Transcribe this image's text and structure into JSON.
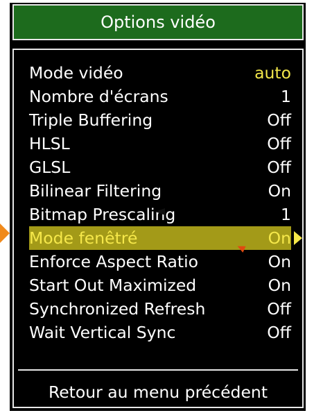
{
  "title": "Options vidéo",
  "items": [
    {
      "label": "Mode vidéo",
      "value": "auto"
    },
    {
      "label": "Nombre d'écrans",
      "value": "1"
    },
    {
      "label": "Triple Buffering",
      "value": "Off"
    },
    {
      "label": "HLSL",
      "value": "Off"
    },
    {
      "label": "GLSL",
      "value": "Off"
    },
    {
      "label": "Bilinear Filtering",
      "value": "On"
    },
    {
      "label": "Bitmap Prescaling",
      "value": "1"
    },
    {
      "label": "Mode fenêtré",
      "value": "On"
    },
    {
      "label": "Enforce Aspect Ratio",
      "value": "On"
    },
    {
      "label": "Start Out Maximized",
      "value": "On"
    },
    {
      "label": "Synchronized Refresh",
      "value": "Off"
    },
    {
      "label": "Wait Vertical Sync",
      "value": "Off"
    }
  ],
  "selected_item": "Mode fenêtré",
  "back_label": "Retour au menu précédent",
  "colors": {
    "title_background": "#1d6b1d",
    "highlight_background": "#a39a18",
    "accent_text": "#f2e64a",
    "marker_orange": "#f08a1c"
  },
  "icons": {
    "selected_value_marker": "triangle-right-icon",
    "pointer": "mouse-cursor-icon",
    "annotation": "orange-marker-icon"
  }
}
